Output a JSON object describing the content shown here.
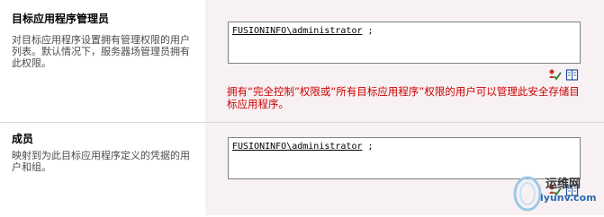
{
  "sections": [
    {
      "title": "目标应用程序管理员",
      "description": "对目标应用程序设置拥有管理权限的用户列表。默认情况下，服务器场管理员拥有此权限。",
      "value_account": "FUSIONINFO\\administrator",
      "value_suffix": " ;",
      "warning": "拥有“完全控制”权限或“所有目标应用程序”权限的用户可以管理此安全存储目标应用程序。"
    },
    {
      "title": "成员",
      "description": "映射到为此目标应用程序定义的凭据的用户和组。",
      "value_account": "FUSIONINFO\\administrator",
      "value_suffix": " ;"
    }
  ],
  "icons": {
    "check_names": "check-names-icon",
    "browse": "address-book-icon"
  },
  "watermark": {
    "line1": "运维网",
    "line2": "iyunv.com"
  },
  "colors": {
    "right_column_bg": "#f7f1f3",
    "warning_text": "#cc0000"
  }
}
